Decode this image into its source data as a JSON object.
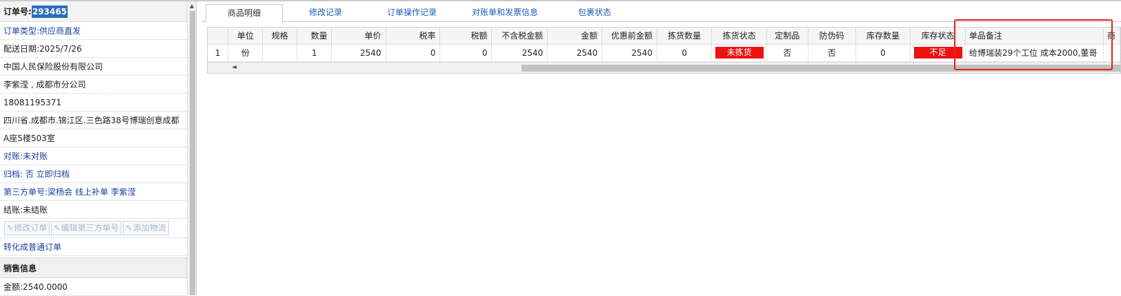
{
  "order": {
    "number_label": "订单号:",
    "number_value": "293465",
    "type": "订单类型:供应商直发",
    "delivery_date": "配送日期:2025/7/26",
    "company": "中国人民保险股份有限公司",
    "contact": "李紫滢 , 成都市分公司",
    "phone": "18081195371",
    "address_line1": "四川省.成都市.锦江区.三色路38号博瑞创意成都",
    "address_line2": "A座5楼503室",
    "reconcile": "对账:未对账",
    "archive": "归档: 否 立即归档",
    "third_party": "第三方单号:梁杨会 线上补单 李紫滢",
    "settlement": "结账:未结账",
    "buttons": [
      "修改订单",
      "编辑第三方单号",
      "添加物流"
    ],
    "convert_link": "转化成普通订单"
  },
  "sales": {
    "section_title": "销售信息",
    "amount": "金额:2540.0000"
  },
  "tabs": [
    "商品明细",
    "修改记录",
    "订单操作记录",
    "对账单和发票信息",
    "包裹状态"
  ],
  "table": {
    "headers": [
      "",
      "单位",
      "规格",
      "数量",
      "单价",
      "税率",
      "税额",
      "不含税金额",
      "金额",
      "优惠前金额",
      "拣货数量",
      "拣货状态",
      "定制品",
      "防伪码",
      "库存数量",
      "库存状态",
      "单品备注",
      "商"
    ],
    "rows": [
      [
        "1",
        "份",
        "",
        "1",
        "2540",
        "0",
        "0",
        "2540",
        "2540",
        "2540",
        "0",
        "未拣货",
        "否",
        "否",
        "0",
        "不足",
        "给博瑞装29个工位 成本2000,董哥",
        ""
      ]
    ]
  },
  "colors": {
    "accent": "#1a5fb4",
    "alert": "#ee1111",
    "highlight_box": "#e82020"
  }
}
